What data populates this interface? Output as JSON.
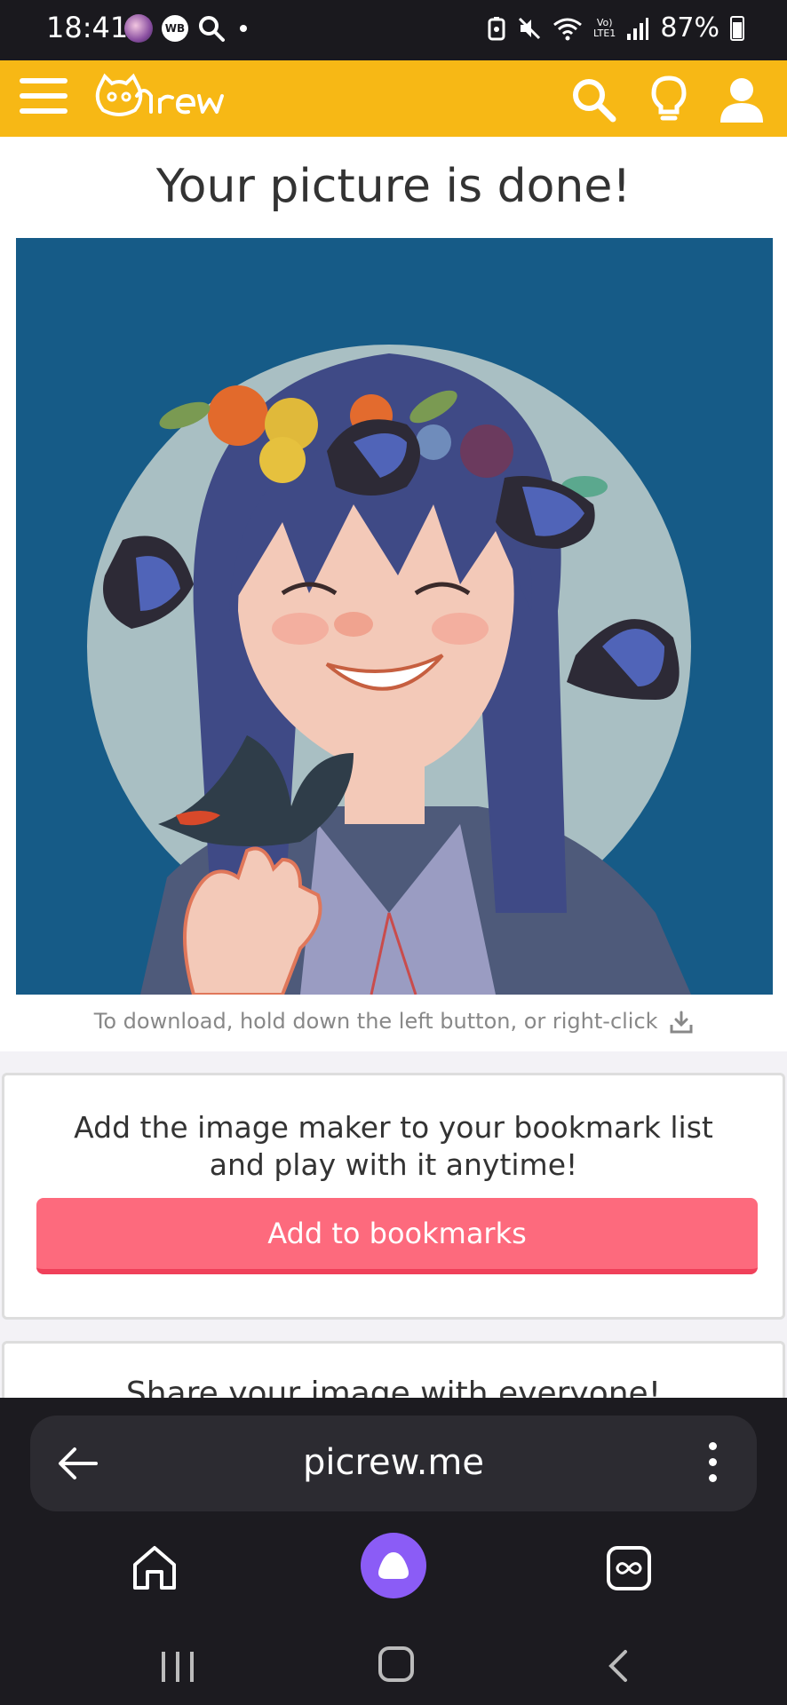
{
  "status_bar": {
    "time": "18:41",
    "wb_label": "WB",
    "lte_top": "Vo)",
    "lte_bottom": "LTE1",
    "battery": "87%"
  },
  "header": {
    "logo_text": "Picrew",
    "brand_color": "#f7b815"
  },
  "result": {
    "title": "Your picture is done!",
    "download_hint": "To download, hold down the left button, or right-click"
  },
  "bookmark": {
    "text_line1": "Add the image maker to your bookmark list",
    "text_line2": "and play with it anytime!",
    "button_label": "Add to bookmarks",
    "button_color": "#fd6a7d"
  },
  "share": {
    "text": "Share your image with everyone!"
  },
  "browser": {
    "url": "picrew.me"
  }
}
